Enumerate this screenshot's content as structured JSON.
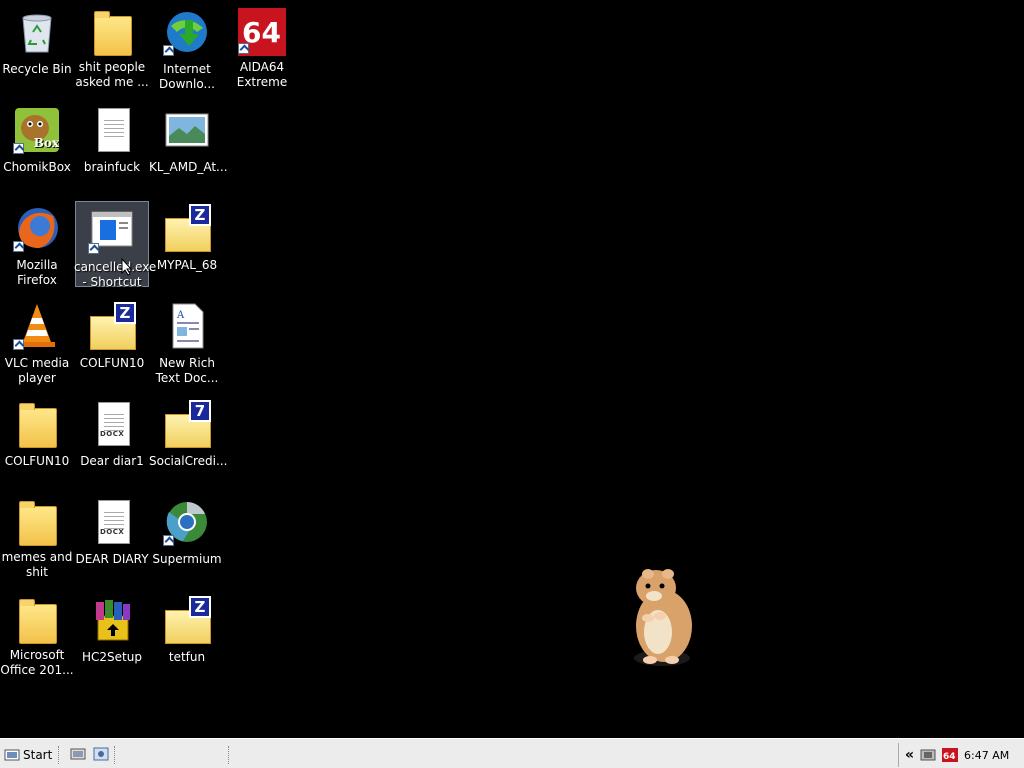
{
  "desktop": {
    "icons": [
      {
        "label": "Recycle Bin"
      },
      {
        "label": "shit people\nasked me ..."
      },
      {
        "label": "Internet\nDownlo..."
      },
      {
        "label": "AIDA64\nExtreme"
      },
      {
        "label": "ChomikBox"
      },
      {
        "label": "brainfuck"
      },
      {
        "label": "KL_AMD_At..."
      },
      {
        "label": "Mozilla\nFirefox"
      },
      {
        "label": "cancelled.exe\n- Shortcut"
      },
      {
        "label": "MYPAL_68"
      },
      {
        "label": "VLC media\nplayer"
      },
      {
        "label": "COLFUN10"
      },
      {
        "label": "New Rich\nText Doc..."
      },
      {
        "label": "COLFUN10"
      },
      {
        "label": "Dear diar1"
      },
      {
        "label": "SocialCredi..."
      },
      {
        "label": "memes and\nshit"
      },
      {
        "label": "DEAR DIARY"
      },
      {
        "label": "Supermium"
      },
      {
        "label": "Microsoft\nOffice 201..."
      },
      {
        "label": "HC2Setup"
      },
      {
        "label": "tetfun"
      }
    ],
    "badges": {
      "aida": "64",
      "chomik": "Box",
      "docx": "DOCX",
      "zip": "Z",
      "sevenzip": "7"
    }
  },
  "taskbar": {
    "start_label": "Start",
    "clock": "6:47 AM",
    "tray_chevron": "«"
  }
}
